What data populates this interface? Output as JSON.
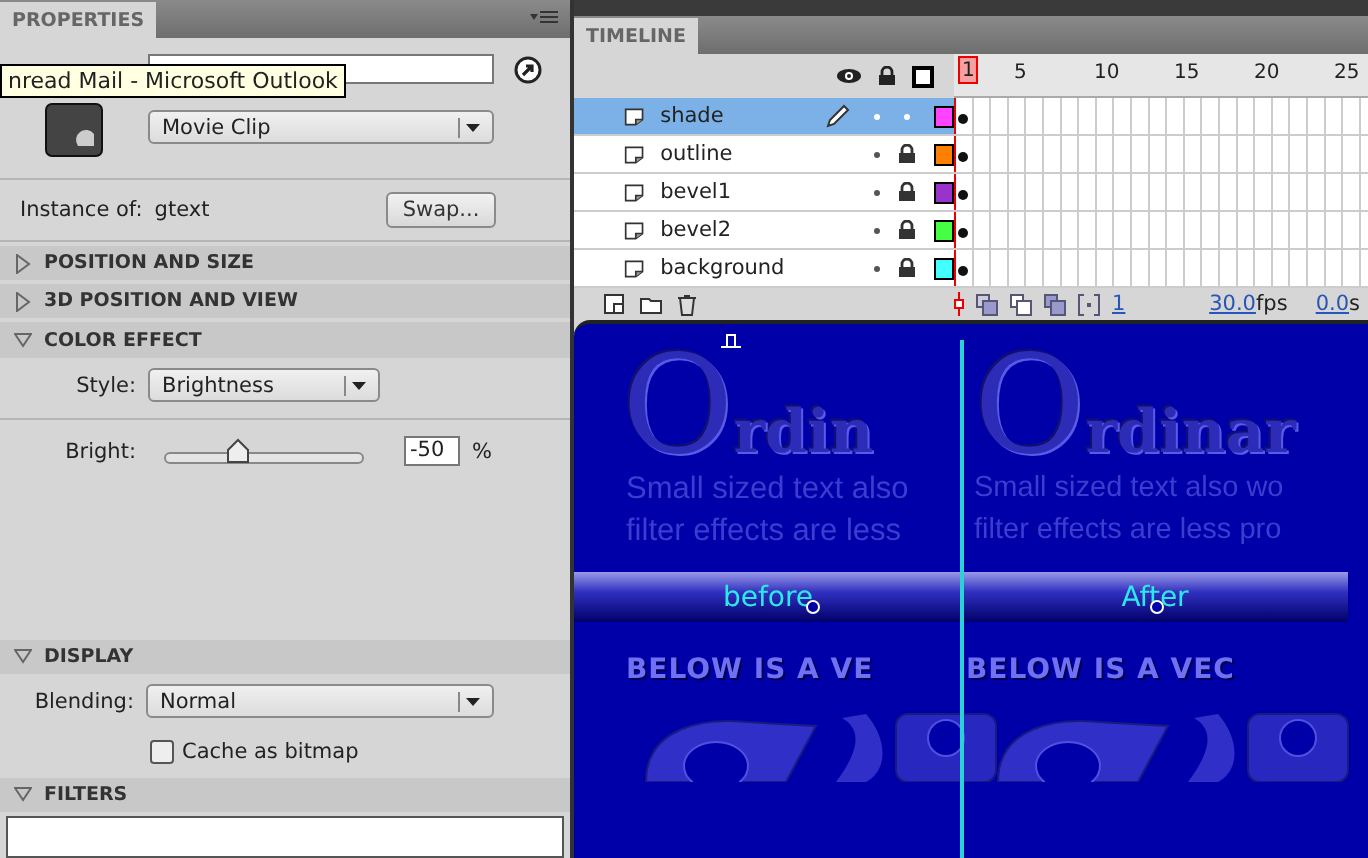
{
  "properties": {
    "tab": "PROPERTIES",
    "tooltip": "nread Mail - Microsoft Outlook",
    "symbol_type": "Movie Clip",
    "instance_label": "Instance of:",
    "instance_value": "gtext",
    "swap_button": "Swap...",
    "sections": [
      {
        "title": "POSITION AND SIZE",
        "expanded": false
      },
      {
        "title": "3D POSITION AND VIEW",
        "expanded": false
      },
      {
        "title": "COLOR EFFECT",
        "expanded": true,
        "kind": "color"
      },
      {
        "title": "DISPLAY",
        "expanded": true,
        "kind": "display"
      },
      {
        "title": "FILTERS",
        "expanded": true
      }
    ],
    "style_label": "Style:",
    "style_value": "Brightness",
    "bright_label": "Bright:",
    "bright": {
      "level": 0.33,
      "value": "-50",
      "unit": "%"
    },
    "blending_label": "Blending:",
    "blending_value": "Normal",
    "cache": {
      "label": "Cache as bitmap",
      "checked": false
    }
  },
  "timeline": {
    "tab": "TIMELINE",
    "frames": [
      "1",
      "5",
      "10",
      "15",
      "20",
      "25"
    ],
    "layers": [
      {
        "name": "shade",
        "selected": true,
        "editing": true,
        "locked": false,
        "color": "#ff44ff"
      },
      {
        "name": "outline",
        "selected": false,
        "editing": false,
        "locked": true,
        "color": "#ff8000"
      },
      {
        "name": "bevel1",
        "selected": false,
        "editing": false,
        "locked": true,
        "color": "#9933cc"
      },
      {
        "name": "bevel2",
        "selected": false,
        "editing": false,
        "locked": true,
        "color": "#44ff44"
      },
      {
        "name": "background",
        "selected": false,
        "editing": false,
        "locked": true,
        "color": "#44ffff"
      }
    ],
    "current_frame": "1",
    "fps": "30.0",
    "fps_unit": "fps",
    "time": "0.0",
    "time_unit": "s"
  },
  "stage": {
    "panels": [
      {
        "title": "Ordin",
        "lines": [
          "Small sized text also",
          "filter effects are less"
        ],
        "button": "before",
        "heading": "BELOW IS A VE"
      },
      {
        "title": "Ordinar",
        "lines": [
          "Small sized text also wo",
          "filter effects are less pro"
        ],
        "button": "After",
        "heading": "BELOW IS A VEC"
      }
    ]
  }
}
